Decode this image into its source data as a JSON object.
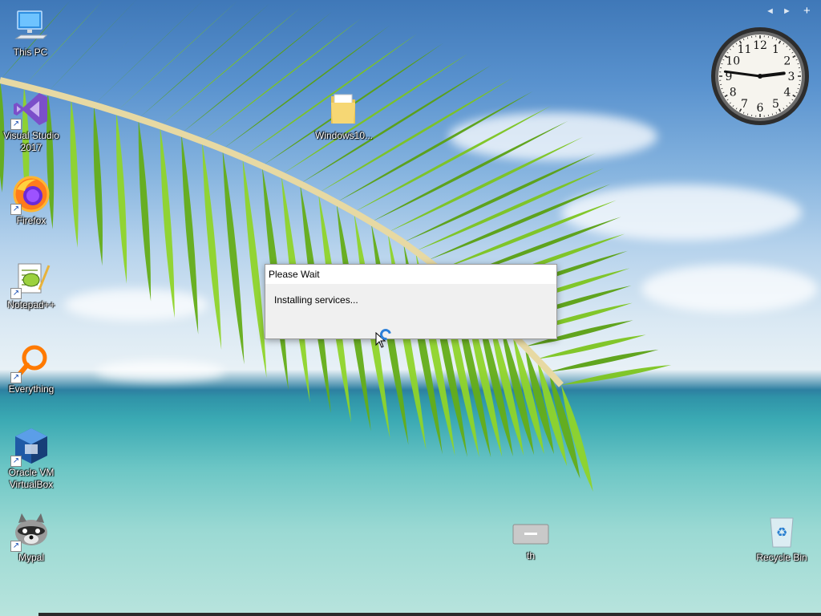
{
  "desktop": {
    "icons_left": [
      {
        "id": "this-pc",
        "label": "This PC",
        "shortcut": false
      },
      {
        "id": "visual-studio",
        "label": "Visual Studio\n2017",
        "shortcut": true
      },
      {
        "id": "firefox",
        "label": "Firefox",
        "shortcut": true
      },
      {
        "id": "notepadpp",
        "label": "Notepad++",
        "shortcut": true
      },
      {
        "id": "everything",
        "label": "Everything",
        "shortcut": true
      },
      {
        "id": "virtualbox",
        "label": "Oracle VM\nVirtualBox",
        "shortcut": true
      },
      {
        "id": "mypal",
        "label": "Mypal",
        "shortcut": true
      }
    ],
    "folder_icon": {
      "label": "Windows10..."
    },
    "th_icon": {
      "label": "th"
    },
    "recycle_bin": {
      "label": "Recycle Bin"
    }
  },
  "dialog": {
    "title": "Please Wait",
    "message": "Installing services..."
  },
  "clock_gadget": {
    "numbers": [
      "12",
      "1",
      "2",
      "3",
      "4",
      "5",
      "6",
      "7",
      "8",
      "9",
      "10",
      "11"
    ],
    "time": {
      "hour": 2,
      "minute": 46,
      "second": 15
    },
    "controls": {
      "prev": "◄",
      "next": "►",
      "add": "+"
    }
  },
  "colors": {
    "accent_spinner": "#2b7fd8",
    "dialog_bg": "#f0f0f0",
    "label_text": "#ffffff"
  }
}
